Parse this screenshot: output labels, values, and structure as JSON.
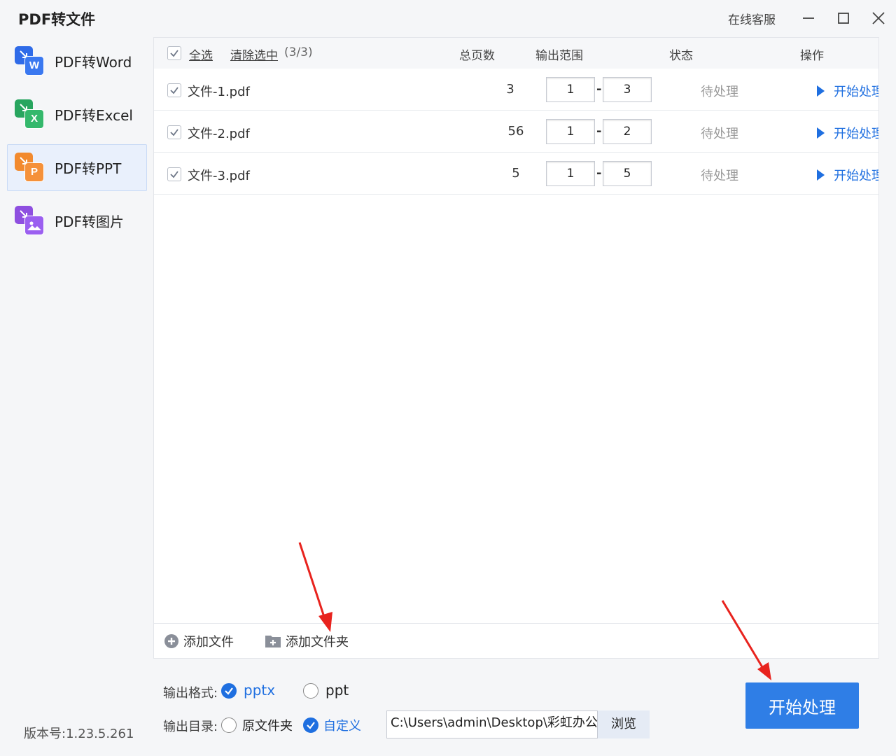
{
  "app": {
    "title": "PDF转文件",
    "online_service": "在线客服",
    "version": "版本号:1.23.5.261"
  },
  "sidebar": {
    "items": [
      {
        "label": "PDF转Word",
        "badge": "W",
        "color": "#2f6be8"
      },
      {
        "label": "PDF转Excel",
        "badge": "X",
        "color": "#28a55f"
      },
      {
        "label": "PDF转PPT",
        "badge": "P",
        "color": "#f28a2e",
        "active": true
      },
      {
        "label": "PDF转图片",
        "badge": "",
        "color": "#8e4fe0"
      }
    ]
  },
  "table": {
    "select_all": "全选",
    "clear_selected": "清除选中",
    "selected_count": "(3/3)",
    "headers": {
      "pages": "总页数",
      "range": "输出范围",
      "status": "状态",
      "action": "操作"
    },
    "range_separator": "-",
    "rows": [
      {
        "name": "文件-1.pdf",
        "pages": "3",
        "from": "1",
        "to": "3",
        "status": "待处理",
        "action": "开始处理"
      },
      {
        "name": "文件-2.pdf",
        "pages": "56",
        "from": "1",
        "to": "2",
        "status": "待处理",
        "action": "开始处理"
      },
      {
        "name": "文件-3.pdf",
        "pages": "5",
        "from": "1",
        "to": "5",
        "status": "待处理",
        "action": "开始处理"
      }
    ]
  },
  "bottom": {
    "add_file": "添加文件",
    "add_folder": "添加文件夹"
  },
  "output": {
    "format_label": "输出格式:",
    "format_options": [
      "pptx",
      "ppt"
    ],
    "format_selected": "pptx",
    "dir_label": "输出目录:",
    "dir_options": [
      "原文件夹",
      "自定义"
    ],
    "dir_selected": "自定义",
    "path": "C:\\Users\\admin\\Desktop\\彩虹办公中心",
    "browse": "浏览",
    "start": "开始处理"
  },
  "colors": {
    "accent": "#2f7ee6",
    "link_blue": "#1f6fe0",
    "annotation_red": "#e8231e"
  }
}
